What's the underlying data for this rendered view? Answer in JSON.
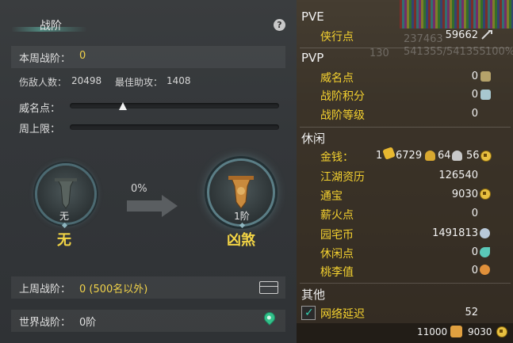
{
  "left_panel": {
    "title": "战阶",
    "help_glyph": "?",
    "weekly_label": "本周战阶：",
    "weekly_value": "0",
    "kills_label": "伤敌人数：",
    "kills_value": "20498",
    "assist_label": "最佳助攻：",
    "assist_value": "1408",
    "prestige_label": "威名点：",
    "weekly_cap_label": "周上限：",
    "current_rank": {
      "sub": "无",
      "name": "无"
    },
    "progress_text": "0%",
    "next_rank": {
      "sub": "1阶",
      "name": "凶煞"
    },
    "last_week_label": "上周战阶：",
    "last_week_value": "0 (500名以外)",
    "world_label": "世界战阶：",
    "world_value": "0阶"
  },
  "right_panel": {
    "pve": {
      "header": "PVE",
      "items": [
        {
          "label": "侠行点",
          "value": "59662"
        }
      ]
    },
    "pvp": {
      "header": "PVP",
      "items": [
        {
          "label": "威名点",
          "value": "0"
        },
        {
          "label": "战阶积分",
          "value": "0"
        },
        {
          "label": "战阶等级",
          "value": "0"
        }
      ]
    },
    "leisure": {
      "header": "休闲",
      "money_label": "金钱：",
      "money_gold": "1",
      "money_silver": "6729",
      "money_copper": "64",
      "money_tin": "56",
      "items": [
        {
          "label": "江湖资历",
          "value": "126540"
        },
        {
          "label": "通宝",
          "value": "9030"
        },
        {
          "label": "薪火点",
          "value": "0"
        },
        {
          "label": "园宅币",
          "value": "1491813"
        },
        {
          "label": "休闲点",
          "value": "0"
        },
        {
          "label": "桃李值",
          "value": "0"
        }
      ]
    },
    "other": {
      "header": "其他",
      "net_label": "网络延迟",
      "net_value": "52",
      "net_checked": true
    },
    "footer": {
      "left_value": "11000",
      "right_value": "9030"
    },
    "background_ghost": {
      "hp_a": "237463",
      "hp_b": "541355/541355",
      "pct": "100%",
      "lvl": "130"
    }
  }
}
